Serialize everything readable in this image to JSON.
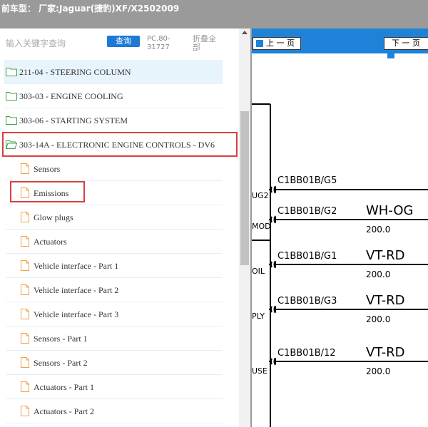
{
  "header": {
    "title": "前车型：  厂家:Jaguar(捷豹)XF/X2502009"
  },
  "search": {
    "placeholder": "输入关键字查询",
    "query_button": "查询",
    "pc_code_line1": "PC.80-",
    "pc_code_line2": "31727",
    "collapse_line1": "折叠全",
    "collapse_line2": "部"
  },
  "tree": {
    "sections": [
      {
        "label": "211-04 - STEERING COLUMN"
      },
      {
        "label": "303-03 - ENGINE COOLING"
      },
      {
        "label": "303-06 - STARTING SYSTEM"
      },
      {
        "label": "303-14A - ELECTRONIC ENGINE CONTROLS - DV6"
      }
    ],
    "children": [
      {
        "label": "Sensors"
      },
      {
        "label": "Emissions"
      },
      {
        "label": "Glow plugs"
      },
      {
        "label": "Actuators"
      },
      {
        "label": "Vehicle interface - Part 1"
      },
      {
        "label": "Vehicle interface - Part 2"
      },
      {
        "label": "Vehicle interface - Part 3"
      },
      {
        "label": "Sensors - Part 1"
      },
      {
        "label": "Sensors - Part 2"
      },
      {
        "label": "Actuators - Part 1"
      },
      {
        "label": "Actuators - Part 2"
      }
    ]
  },
  "viewer": {
    "prev_label": "上 一 页",
    "next_label": "下 一 页",
    "wires": [
      {
        "pin": "UG2",
        "connector": "C1BB01B/G5",
        "color": "",
        "gauge": ""
      },
      {
        "pin": "MOD",
        "connector": "C1BB01B/G2",
        "color": "WH-OG",
        "gauge": "200.0"
      },
      {
        "pin": "OIL",
        "connector": "C1BB01B/G1",
        "color": "VT-RD",
        "gauge": "200.0"
      },
      {
        "pin": "PLY",
        "connector": "C1BB01B/G3",
        "color": "VT-RD",
        "gauge": "200.0"
      },
      {
        "pin": "USE",
        "connector": "C1BB01B/12",
        "color": "VT-RD",
        "gauge": "200.0"
      }
    ]
  },
  "colors": {
    "header_bg": "#9a9a9a",
    "accent_blue": "#1e83d8",
    "query_button_bg": "#1d78d6",
    "highlight_red": "#d84040",
    "folder_green": "#3fa34d",
    "doc_orange": "#f0a04b"
  }
}
